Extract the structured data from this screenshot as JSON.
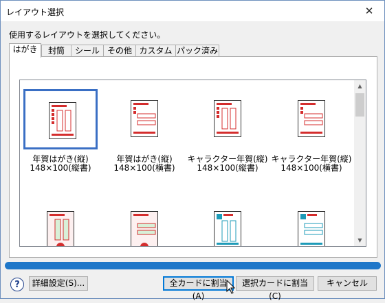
{
  "window": {
    "title": "レイアウト選択",
    "close_glyph": "✕"
  },
  "prompt": "使用するレイアウトを選択してください。",
  "tabs": [
    {
      "label": "はがき",
      "active": true
    },
    {
      "label": "封筒"
    },
    {
      "label": "シール"
    },
    {
      "label": "その他"
    },
    {
      "label": "カスタム"
    },
    {
      "label": "パック済み"
    }
  ],
  "layouts": [
    {
      "name": "年賀はがき(縦)",
      "size": "148×100(縦書)",
      "selected": true
    },
    {
      "name": "年賀はがき(縦)",
      "size": "148×100(横書)"
    },
    {
      "name": "キャラクター年賀(縦)",
      "size": "148×100(縦書)"
    },
    {
      "name": "キャラクター年賀(縦)",
      "size": "148×100(横書)"
    },
    {
      "name": "",
      "size": ""
    },
    {
      "name": "",
      "size": ""
    },
    {
      "name": "",
      "size": ""
    },
    {
      "name": "",
      "size": ""
    }
  ],
  "buttons": {
    "help": "?",
    "detail": "詳細設定(S)...",
    "assign_all": "全カードに割当(A)",
    "assign_selected": "選択カードに割当(C)",
    "cancel": "キャンセル"
  },
  "scrollbar": {
    "up": "▲",
    "down": "▼"
  },
  "colors": {
    "selection": "#3a6fc4",
    "progress": "#1f77c9",
    "card_red": "#d42d2d",
    "card_teal": "#1d9bb8"
  }
}
